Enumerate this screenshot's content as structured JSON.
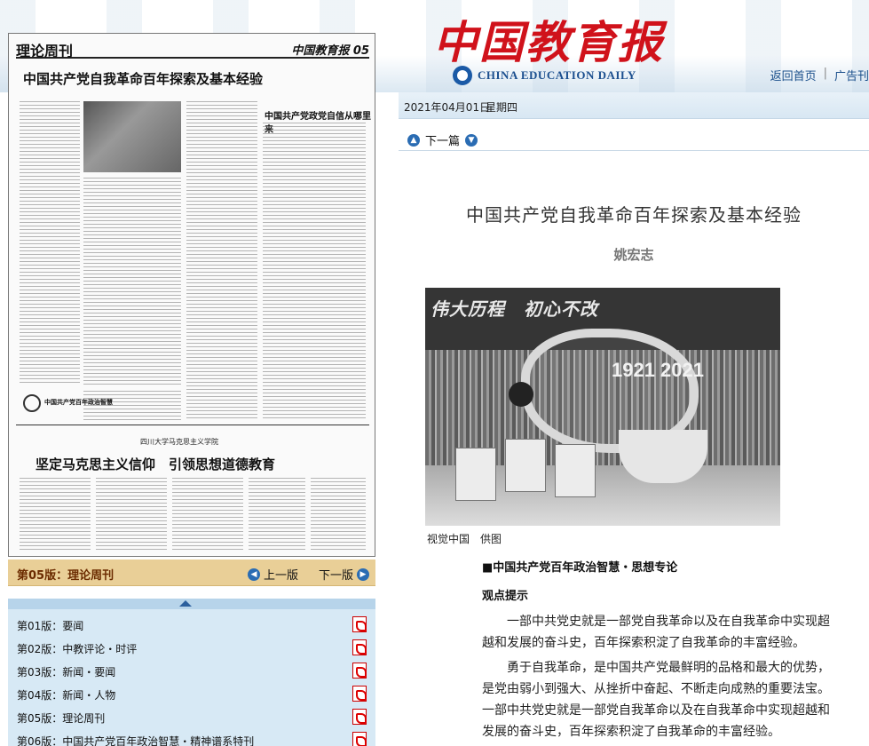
{
  "header": {
    "logo_cn": "中国教育报",
    "logo_en": "CHINA EDUCATION DAILY",
    "links": [
      "返回首页",
      "广告刊"
    ],
    "link_sep": "|"
  },
  "paper_thumb": {
    "head_title": "理论周刊",
    "head_right": "中国教育报 05",
    "main_headline": "中国共产党自我革命百年探索及基本经验",
    "side_headline": "中国共产党政党自信从哪里来",
    "seal_label": "中国共产党百年政治智慧",
    "bottom_sub": "四川大学马克思主义学院",
    "bottom_headline": "坚定马克思主义信仰　引领思想道德教育"
  },
  "page_bar": {
    "current": "第05版：理论周刊",
    "prev_label": "上一版",
    "next_label": "下一版"
  },
  "page_list": [
    {
      "label": "第01版：要闻"
    },
    {
      "label": "第02版：中教评论・时评"
    },
    {
      "label": "第03版：新闻・要闻"
    },
    {
      "label": "第04版：新闻・人物"
    },
    {
      "label": "第05版：理论周刊"
    },
    {
      "label": "第06版：中国共产党百年政治智慧・精神谱系特刊"
    }
  ],
  "article": {
    "date": "2021年04月01日",
    "weekday": "星期四",
    "next_label": "下一篇",
    "title": "中国共产党自我革命百年探索及基本经验",
    "author": "姚宏志",
    "photo_banner": "伟大历程　初心不改",
    "photo_year": "1921 2021",
    "caption": "视觉中国　供图",
    "section_tag": "■中国共产党百年政治智慧・思想专论",
    "viewpoint": "观点提示",
    "paragraphs": [
      "一部中共党史就是一部党自我革命以及在自我革命中实现超越和发展的奋斗史，百年探索积淀了自我革命的丰富经验。",
      "勇于自我革命，是中国共产党最鲜明的品格和最大的优势，是党由弱小到强大、从挫折中奋起、不断走向成熟的重要法宝。一部中共党史就是一部党自我革命以及在自我革命中实现超越和发展的奋斗史，百年探索积淀了自我革命的丰富经验。"
    ]
  },
  "colors": {
    "logo_red": "#d0121b",
    "link_blue": "#1a4f8b",
    "pagebar_bg": "#e9cf97",
    "list_bg": "#d7e9f5"
  }
}
